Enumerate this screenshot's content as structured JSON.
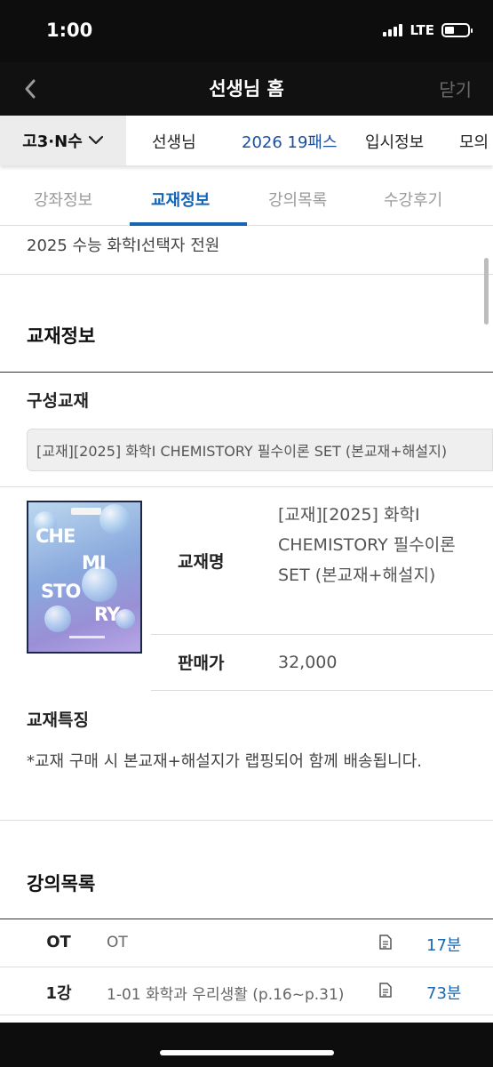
{
  "status_bar": {
    "time": "1:00",
    "network": "LTE"
  },
  "header": {
    "title": "선생님 홈",
    "close_label": "닫기"
  },
  "category_bar": {
    "grade_label": "고3·N수",
    "items": [
      "선생님",
      "2026 19패스",
      "입시정보",
      "모의"
    ],
    "active_index": 1
  },
  "sub_tabs": {
    "items": [
      "강좌정보",
      "교재정보",
      "강의목록",
      "수강후기"
    ],
    "active_index": 1
  },
  "target": "2025 수능 화학Ⅰ선택자 전원",
  "textbook_section": {
    "title": "교재정보",
    "composition_title": "구성교재",
    "set_name": "[교재][2025] 화학Ⅰ CHEMISTORY 필수이론 SET (본교재+해설지)",
    "cover_text": [
      "CHE",
      "MI",
      "STO",
      "RY"
    ],
    "name_label": "교재명",
    "name_value": "[교재][2025] 화학Ⅰ CHEMISTORY 필수이론 SET (본교재+해설지)",
    "price_label": "판매가",
    "price_value": "32,000",
    "feature_title": "교재특징",
    "feature_text": "*교재 구매 시 본교재+해설지가 랩핑되어 함께 배송됩니다."
  },
  "lecture_section": {
    "title": "강의목록",
    "rows": [
      {
        "no": "OT",
        "title": "OT",
        "duration": "17분"
      },
      {
        "no": "1강",
        "title": "1-01 화학과 우리생활 (p.16~p.31)",
        "duration": "73분"
      }
    ]
  },
  "colors": {
    "accent": "#1565b5",
    "header_bg": "#111111",
    "link": "#1a67b0"
  }
}
